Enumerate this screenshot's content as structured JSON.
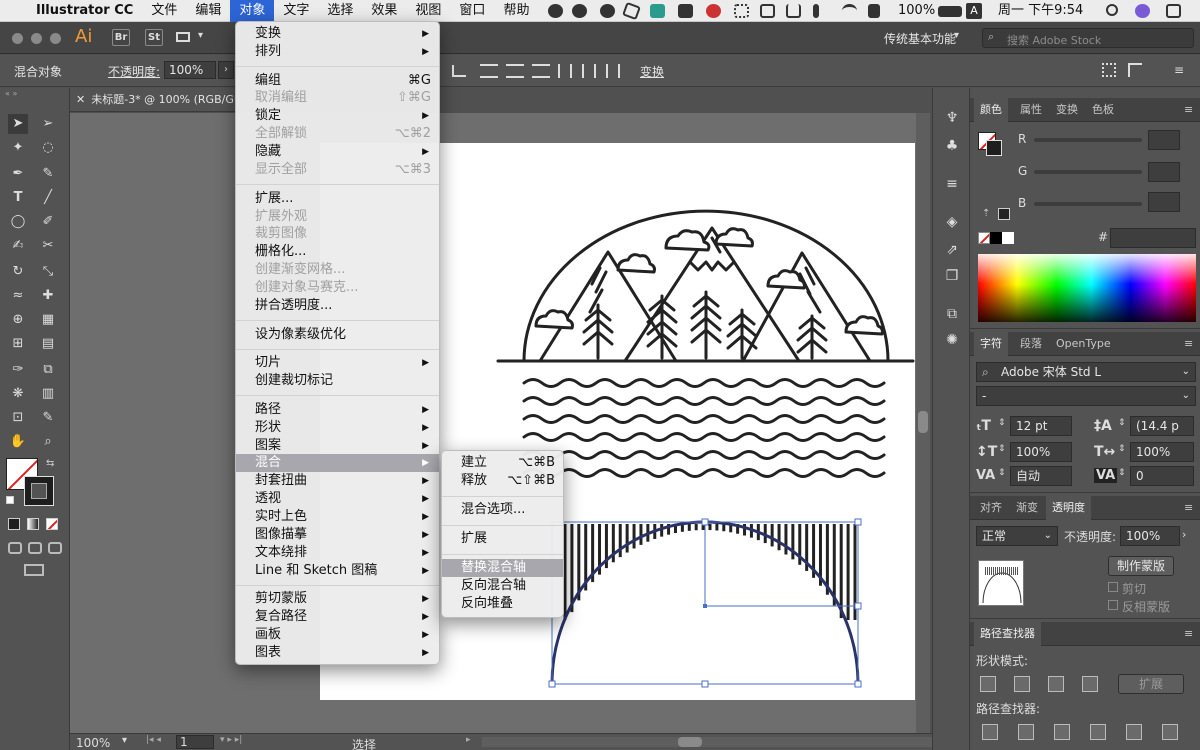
{
  "menubar": {
    "apple": "",
    "app_name": "Illustrator CC",
    "items": [
      "文件",
      "编辑",
      "对象",
      "文字",
      "选择",
      "效果",
      "视图",
      "窗口",
      "帮助"
    ],
    "active_item": "对象",
    "battery": "100%",
    "input_method": "A",
    "clock": "周一 下午9:54"
  },
  "appbar": {
    "logo": "Ai",
    "bridge": "Br",
    "stock": "St",
    "workspace": "传统基本功能",
    "search_placeholder": "搜索 Adobe Stock"
  },
  "control_bar": {
    "selection_type": "混合对象",
    "opacity_label": "不透明度:",
    "opacity_value": "100%",
    "transform_label": "变换"
  },
  "document": {
    "tab_title": "未标题-3* @ 100% (RGB/GPU 预览)",
    "zoom": "100%",
    "artboard_index": "1",
    "status_tool": "选择"
  },
  "object_menu": {
    "items": [
      {
        "label": "变换",
        "sub": true
      },
      {
        "label": "排列",
        "sub": true
      },
      {
        "sep": true
      },
      {
        "label": "编组",
        "shortcut": "⌘G"
      },
      {
        "label": "取消编组",
        "shortcut": "⇧⌘G",
        "disabled": true
      },
      {
        "label": "锁定",
        "sub": true
      },
      {
        "label": "全部解锁",
        "shortcut": "⌥⌘2",
        "disabled": true
      },
      {
        "label": "隐藏",
        "sub": true
      },
      {
        "label": "显示全部",
        "shortcut": "⌥⌘3",
        "disabled": true
      },
      {
        "sep": true
      },
      {
        "label": "扩展..."
      },
      {
        "label": "扩展外观",
        "disabled": true
      },
      {
        "label": "裁剪图像",
        "disabled": true
      },
      {
        "label": "栅格化..."
      },
      {
        "label": "创建渐变网格...",
        "disabled": true
      },
      {
        "label": "创建对象马赛克...",
        "disabled": true
      },
      {
        "label": "拼合透明度..."
      },
      {
        "sep": true
      },
      {
        "label": "设为像素级优化"
      },
      {
        "sep": true
      },
      {
        "label": "切片",
        "sub": true
      },
      {
        "label": "创建裁切标记"
      },
      {
        "sep": true
      },
      {
        "label": "路径",
        "sub": true
      },
      {
        "label": "形状",
        "sub": true
      },
      {
        "label": "图案",
        "sub": true
      },
      {
        "label": "混合",
        "sub": true,
        "highlight": true
      },
      {
        "label": "封套扭曲",
        "sub": true
      },
      {
        "label": "透视",
        "sub": true
      },
      {
        "label": "实时上色",
        "sub": true
      },
      {
        "label": "图像描摹",
        "sub": true
      },
      {
        "label": "文本绕排",
        "sub": true
      },
      {
        "label": "Line 和 Sketch 图稿",
        "sub": true
      },
      {
        "sep": true
      },
      {
        "label": "剪切蒙版",
        "sub": true
      },
      {
        "label": "复合路径",
        "sub": true
      },
      {
        "label": "画板",
        "sub": true
      },
      {
        "label": "图表",
        "sub": true
      }
    ]
  },
  "blend_submenu": {
    "items": [
      {
        "label": "建立",
        "shortcut": "⌥⌘B"
      },
      {
        "label": "释放",
        "shortcut": "⌥⇧⌘B"
      },
      {
        "sep": true
      },
      {
        "label": "混合选项..."
      },
      {
        "sep": true
      },
      {
        "label": "扩展"
      },
      {
        "sep": true
      },
      {
        "label": "替换混合轴",
        "highlight": true
      },
      {
        "label": "反向混合轴"
      },
      {
        "label": "反向堆叠"
      }
    ]
  },
  "color_panel": {
    "tabs": [
      "颜色",
      "属性",
      "变换",
      "色板"
    ],
    "channels": [
      "R",
      "G",
      "B"
    ],
    "hex_label": "#"
  },
  "character_panel": {
    "tabs": [
      "字符",
      "段落",
      "OpenType"
    ],
    "font_family": "Adobe 宋体 Std L",
    "font_style": "-",
    "size": "12 pt",
    "leading": "(14.4 p",
    "vscale": "100%",
    "hscale": "100%",
    "kerning": "自动",
    "tracking": "0"
  },
  "transparency_panel": {
    "tabs": [
      "对齐",
      "渐变",
      "透明度"
    ],
    "blend_mode": "正常",
    "opacity_label": "不透明度:",
    "opacity_value": "100%",
    "make_mask": "制作蒙版",
    "clip": "剪切",
    "invert": "反相蒙版"
  },
  "pathfinder_panel": {
    "title": "路径查找器",
    "shape_modes": "形状模式:",
    "expand": "扩展",
    "pathfinders": "路径查找器:"
  },
  "colors": {
    "menu_highlight": "#a7a7ad",
    "menubar_active": "#2d64d6",
    "selection": "#4a6fc8",
    "art_stroke": "#222222"
  }
}
